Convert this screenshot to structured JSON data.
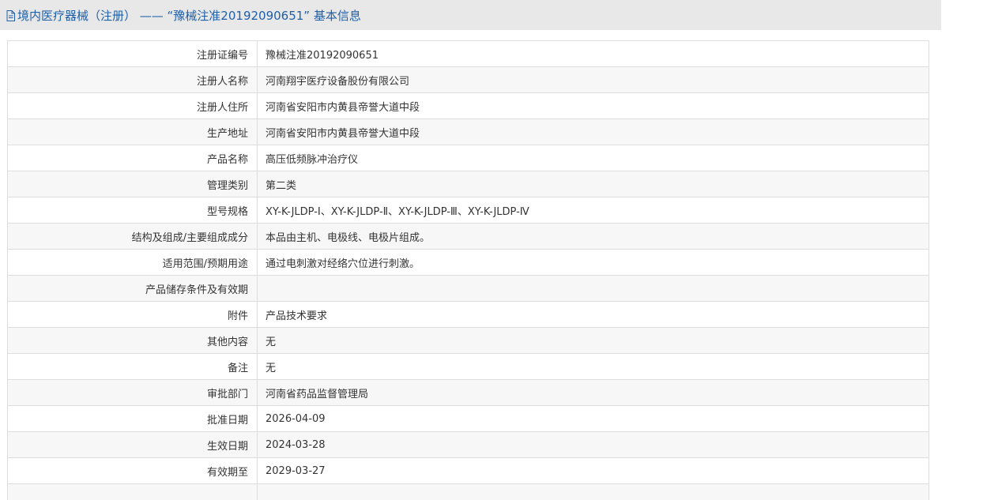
{
  "header": {
    "title": "境内医疗器械（注册） —— “豫械注准20192090651” 基本信息",
    "icon": "document-icon",
    "color": "#1f5fa8"
  },
  "rows": [
    {
      "label": "注册证编号",
      "value": "豫械注准20192090651"
    },
    {
      "label": "注册人名称",
      "value": "河南翔宇医疗设备股份有限公司"
    },
    {
      "label": "注册人住所",
      "value": "河南省安阳市内黄县帝誉大道中段"
    },
    {
      "label": "生产地址",
      "value": "河南省安阳市内黄县帝誉大道中段"
    },
    {
      "label": "产品名称",
      "value": "高压低频脉冲治疗仪"
    },
    {
      "label": "管理类别",
      "value": "第二类"
    },
    {
      "label": "型号规格",
      "value": "XY-K-JLDP-Ⅰ、XY-K-JLDP-Ⅱ、XY-K-JLDP-Ⅲ、XY-K-JLDP-Ⅳ"
    },
    {
      "label": "结构及组成/主要组成成分",
      "value": "本品由主机、电极线、电极片组成。"
    },
    {
      "label": "适用范围/预期用途",
      "value": "通过电刺激对经络穴位进行刺激。"
    },
    {
      "label": "产品储存条件及有效期",
      "value": ""
    },
    {
      "label": "附件",
      "value": "产品技术要求"
    },
    {
      "label": "其他内容",
      "value": "无"
    },
    {
      "label": "备注",
      "value": "无"
    },
    {
      "label": "审批部门",
      "value": "河南省药品监督管理局"
    },
    {
      "label": "批准日期",
      "value": "2026-04-09"
    },
    {
      "label": "生效日期",
      "value": "2024-03-28"
    },
    {
      "label": "有效期至",
      "value": "2029-03-27"
    },
    {
      "label": "",
      "value": ""
    }
  ]
}
